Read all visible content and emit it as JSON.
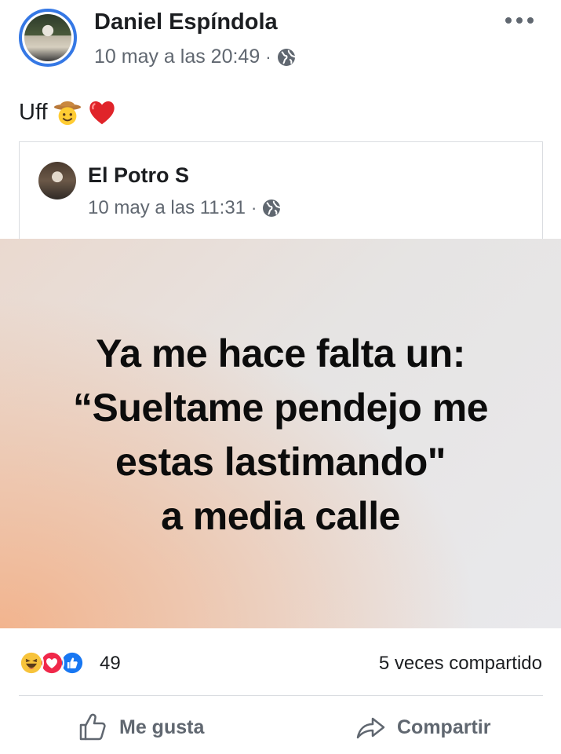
{
  "post": {
    "author": "Daniel Espíndola",
    "timestamp": "10 may a las 20:49",
    "separator": "·",
    "privacy_icon": "globe-icon",
    "menu_icon": "more-options-icon",
    "text": "Uff",
    "emojis": [
      "cowboy-face-icon",
      "red-heart-icon"
    ]
  },
  "shared_post": {
    "author": "El Potro S",
    "timestamp": "10 may a las 11:31",
    "separator": "·",
    "privacy_icon": "globe-icon",
    "image_text": {
      "line1": "Ya me hace falta un:",
      "line2": "“Sueltame pendejo me",
      "line3": "estas lastimando\"",
      "line4": "a media calle"
    }
  },
  "stats": {
    "reactions": [
      "haha-icon",
      "love-icon",
      "like-icon"
    ],
    "reaction_count": "49",
    "shares": "5 veces compartido"
  },
  "actions": {
    "like_label": "Me gusta",
    "share_label": "Compartir"
  },
  "colors": {
    "link_blue": "#3578e5",
    "secondary_text": "#606770",
    "divider": "#dadde1"
  }
}
